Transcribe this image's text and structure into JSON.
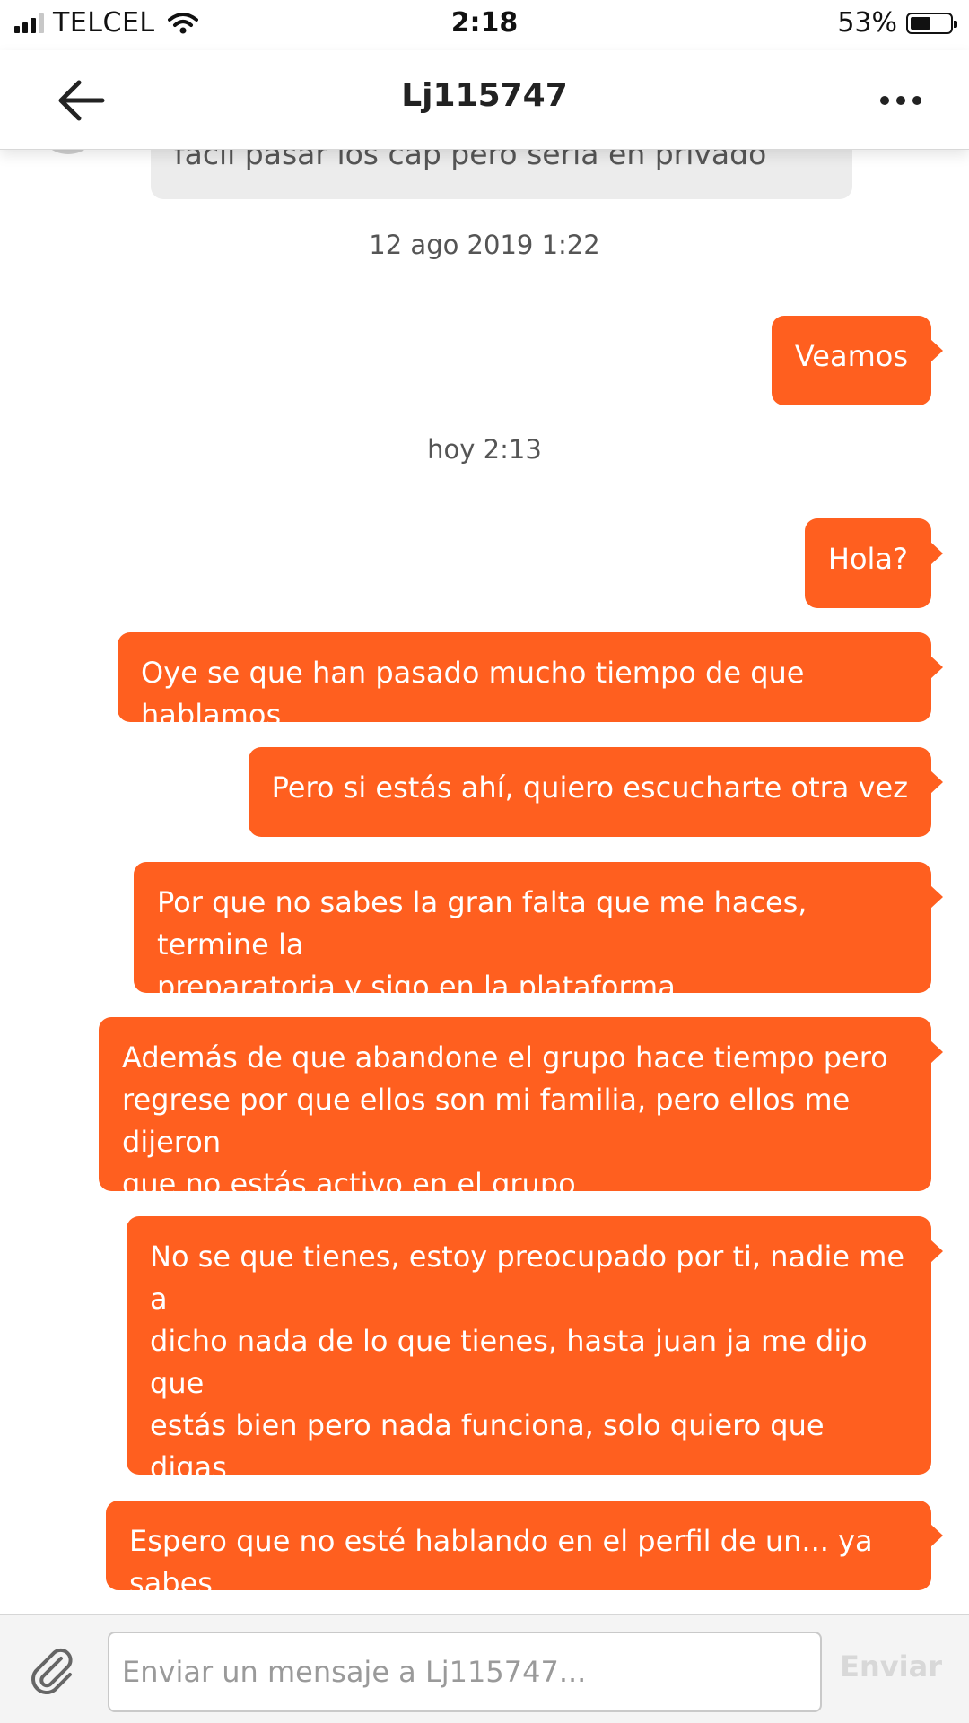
{
  "status_bar": {
    "carrier": "TELCEL",
    "time": "2:18",
    "battery": "53%",
    "battery_level": 0.53
  },
  "header": {
    "title": "Lj115747"
  },
  "conversation": {
    "partial_received": "facil pasar los cap pero seria en privado",
    "timestamp_1": "12 ago 2019 1:22",
    "timestamp_2": "hoy 2:13",
    "sent": [
      "Veamos",
      "Hola?",
      "Oye se que han pasado mucho tiempo de que hablamos",
      "Pero si estás ahí, quiero escucharte otra vez",
      "Por que no sabes la gran falta que me haces, termine la\npreparatoria y sigo en la plataforma",
      "Además de que abandone el grupo hace tiempo pero\nregrese por que ellos son mi familia, pero ellos me dijeron\nque no estás activo en el grupo",
      "No se que tienes, estoy preocupado por ti, nadie me a\ndicho nada de lo que tienes, hasta juan ja me dijo que\nestás bien pero nada funciona, solo quiero que digas\n(estoy bien, tranquilo) espero que estés bien por que en\nserio estoy muy preocupado por ti",
      "Espero que no esté hablando en el perfil de un... ya sabes"
    ]
  },
  "composer": {
    "placeholder": "Enviar un mensaje a Lj115747...",
    "send_label": "Enviar"
  },
  "colors": {
    "accent": "#ff5f1f",
    "received_bubble": "#ececec"
  }
}
